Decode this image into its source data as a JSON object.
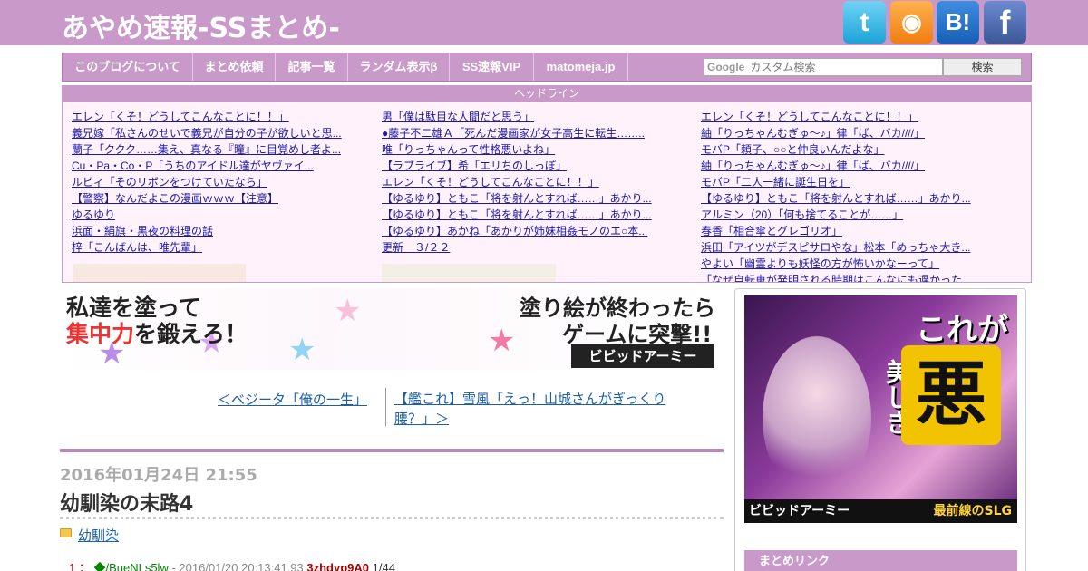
{
  "site": {
    "title": "あやめ速報-SSまとめ-"
  },
  "social": {
    "twitter_glyph": "t",
    "rss_glyph": "◉",
    "hatena_glyph": "B!",
    "facebook_glyph": "f"
  },
  "nav": {
    "items": [
      "このブログについて",
      "まとめ依頼",
      "記事一覧",
      "ランダム表示β",
      "SS速報VIP",
      "matomeja.jp"
    ],
    "search_placeholder": "カスタム検索",
    "search_logo": "Google",
    "search_button": "検索"
  },
  "headline": {
    "title": "ヘッドライン",
    "col1": [
      "エレン「くそ！どうしてこんなことに！！」",
      "義兄嫁「私さんのせいで義兄が自分の子が欲しいと思...",
      "蘭子「ククク……集え、真なる『瞳』に目覚めし者よ...",
      "Cu・Pa・Co・P「うちのアイドル達がヤヴァイ...",
      "ルビィ「そのリボンをつけていたなら」",
      "【警察】なんだよこの漫画ｗｗｗ【注意】",
      "ゆるゆり",
      "浜面・絹旗・黒夜の料理の話",
      "梓「こんばんは、唯先輩」"
    ],
    "col2": [
      "男「僕は駄目な人間だと思う」",
      "●藤子不二雄Ａ「死んだ漫画家が女子高生に転生……..",
      "唯「りっちゃんって性格悪いよね」",
      "【ラブライブ】希「エリちのしっぽ」",
      "エレン「くそ！どうしてこんなことに！！」",
      "【ゆるゆり】ともこ「将を射んとすれば……」あかり...",
      "【ゆるゆり】ともこ「将を射んとすれば……」あかり...",
      "【ゆるゆり】あかね「あかりが姉妹相姦モノのエ○本...",
      "更新　３/２２"
    ],
    "col3": [
      "エレン「くそ！どうしてこんなことに！！」",
      "紬「りっちゃんむぎゅ～♪」律「ば、バカ////」",
      "モバP「頼子、○○と仲良いんだよな」",
      "紬「りっちゃんむぎゅ～♪」律「ば、バカ////」",
      "モバP「二人一緒に誕生日を」",
      "【ゆるゆり】ともこ「将を射んとすれば……」あかり...",
      "アルミン（20）「何も捨てることが……」",
      "春香「相合傘とグレゴリオ」",
      "浜田「アイツがデスピサロやな」松本「めっちゃ大き...",
      "やよい「幽霊よりも妖怪の方が怖いかなーって」",
      "「なぜ自転車が発明される時期はこんなにも遅かった..."
    ]
  },
  "banner": {
    "line1": "私達を塗って",
    "line2_red": "集中力",
    "line2_rest": "を鍛えろ！",
    "right1": "塗り絵が終わったら",
    "right2": "ゲームに突撃!!",
    "brand": "ビビッドアーミー"
  },
  "pager": {
    "prev": "＜ベジータ「俺の一生」",
    "next": "【艦これ】雪風「えっ！山城さんがぎっくり腰？」＞"
  },
  "post": {
    "date": "2016年01月24日 21:55",
    "title": "幼馴染の末路4",
    "category": "幼馴染",
    "first_res": {
      "num": "1 ：",
      "name": "◆/BueNLs5lw",
      "date": "- 2016/01/20 20:13:41.93",
      "id": "3zhdyp9A0",
      "count": "1/44"
    }
  },
  "sidebar": {
    "ad": {
      "line1": "これが",
      "big": "悪",
      "vertical": "美しき",
      "brand": "ビビッドアーミー",
      "tagline": "最前線のSLG"
    },
    "section_title": "まとめリンク"
  },
  "colors": {
    "brand": "#c899c9",
    "headline_bg": "#fff2fb",
    "link": "#1a1aa6"
  }
}
